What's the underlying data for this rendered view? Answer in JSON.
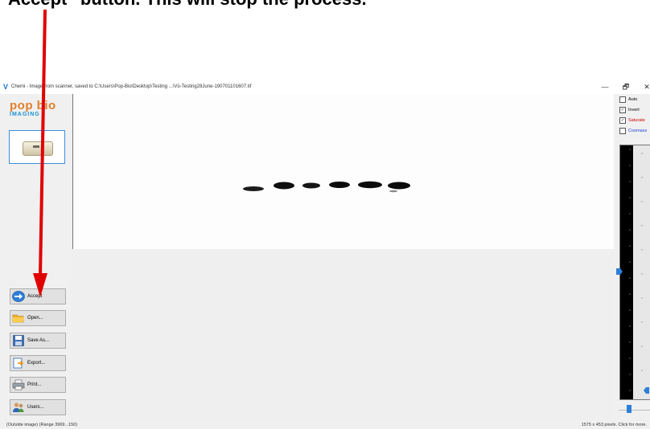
{
  "instruction": {
    "text": "Accept\" button. This will stop the process."
  },
  "window": {
    "app_icon": "V",
    "title": "Chemi - Image from scanner, saved to C:\\Users\\Pop-Bio\\Desktop\\Testing ...\\Vü-Testing28June-190701101607.tif",
    "minimize": "—",
    "restore": "🗗",
    "close": "✕"
  },
  "brand": {
    "top": "pop bio",
    "bottom": "IMAGING"
  },
  "toolbar": {
    "accept_label": "Accept",
    "open_label": "Open...",
    "save_as_label": "Save As...",
    "export_label": "Export...",
    "print_label": "Print...",
    "users_label": "Users..."
  },
  "options": {
    "auto": {
      "label": "Auto",
      "checked": false
    },
    "invert": {
      "label": "Invert",
      "checked": true
    },
    "saturate": {
      "label": "Saturate",
      "checked": true,
      "color": "#cc0000"
    },
    "coomassie": {
      "label": "Coomass",
      "checked": false,
      "color": "#1a3fd6"
    }
  },
  "status": {
    "left": "(Outside image)   (Range 3969...150)",
    "right": "1575 x 453 pixels. Click for more."
  },
  "colors": {
    "accent": "#3a8fe0",
    "annotation_arrow": "#e00000"
  }
}
